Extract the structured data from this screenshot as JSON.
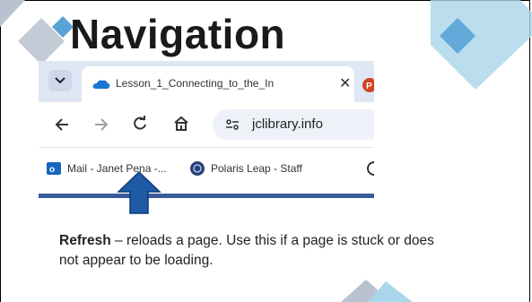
{
  "slide": {
    "title": "Navigation",
    "caption_bold": "Refresh",
    "caption_rest": " – reloads a page. Use this if a page is stuck  or does not appear to be loading."
  },
  "browser": {
    "tab": {
      "title": "Lesson_1_Connecting_to_the_In",
      "close": "✕"
    },
    "toolbar": {
      "url": "jclibrary.info"
    },
    "bookmarks": [
      {
        "label": "Mail - Janet Pena -...",
        "icon": "outlook-icon"
      },
      {
        "label": "Polaris Leap - Staff",
        "icon": "polaris-icon"
      }
    ]
  },
  "colors": {
    "accent_arrow": "#1f5aa6",
    "deco_light": "#a9d6ea",
    "deco_dark": "#5aa3d6",
    "deco_gray": "#b9c3cf"
  }
}
